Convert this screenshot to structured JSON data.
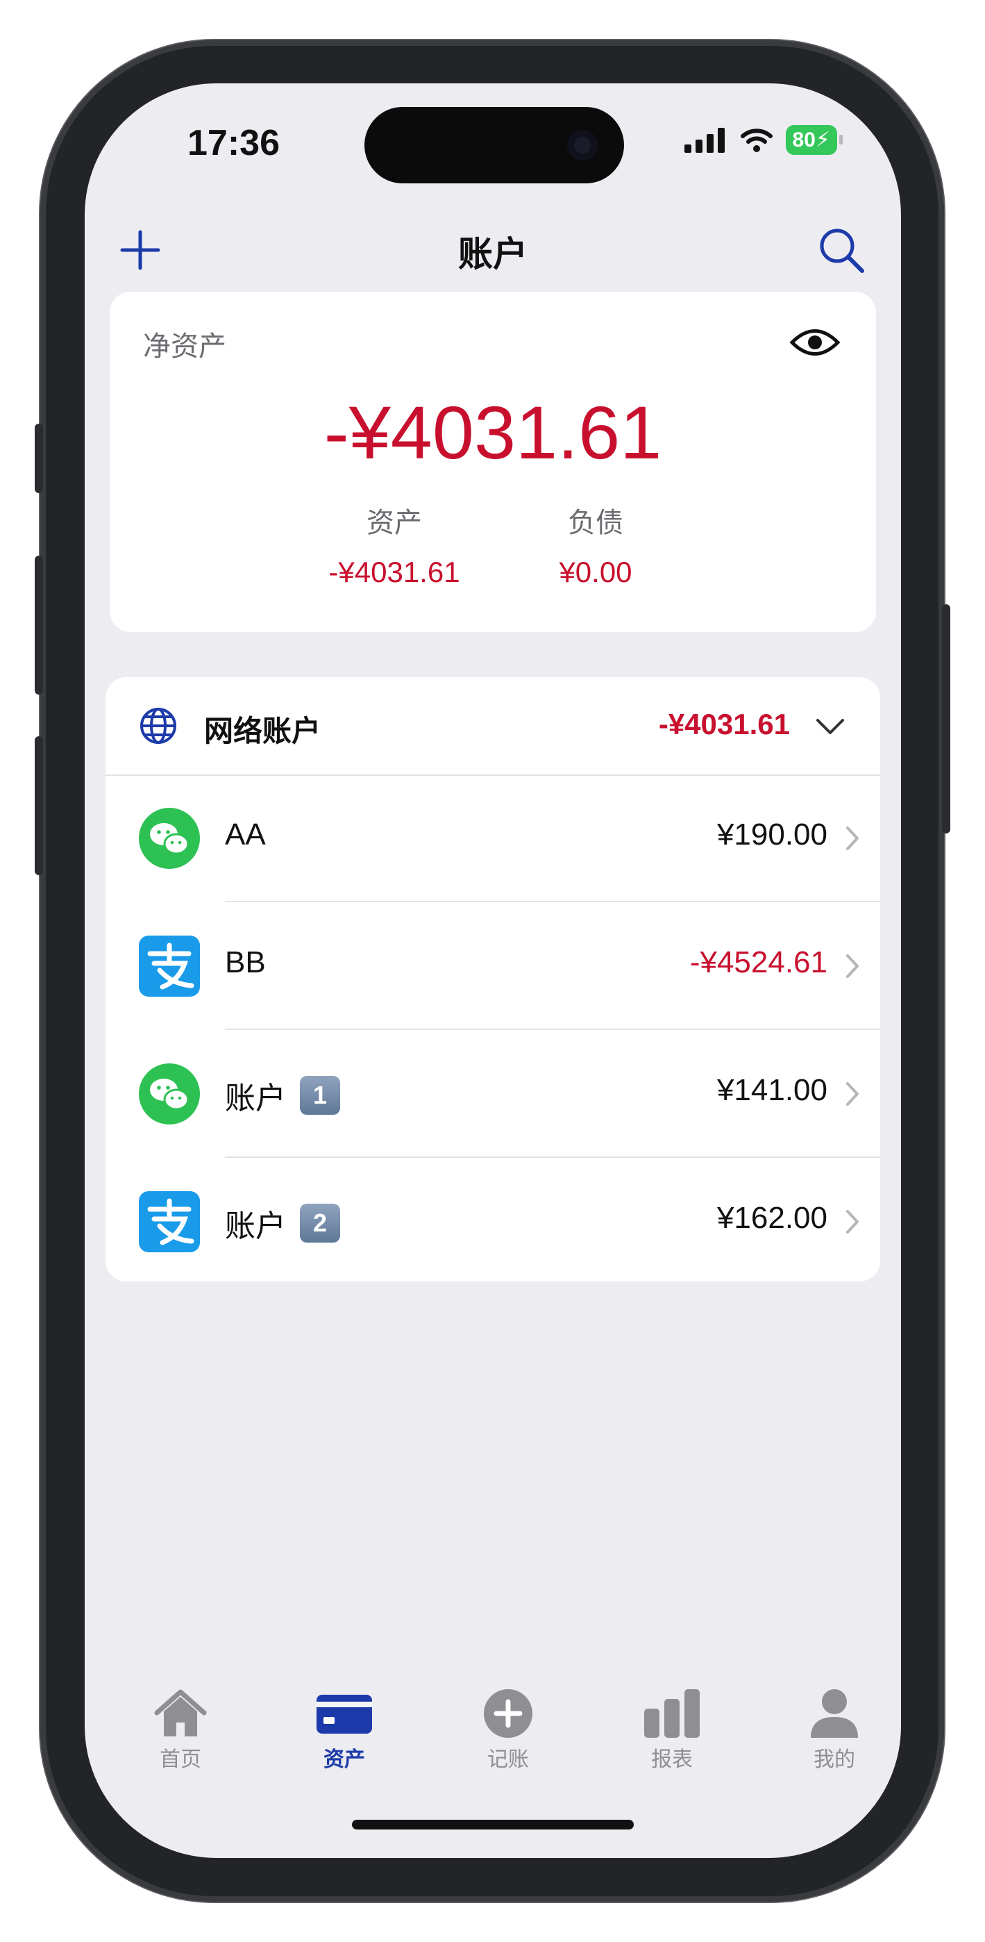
{
  "status": {
    "time": "17:36",
    "battery": "80"
  },
  "nav": {
    "title": "账户"
  },
  "net": {
    "label": "净资产",
    "amount": "-¥4031.61",
    "assets_label": "资产",
    "assets_value": "-¥4031.61",
    "liabilities_label": "负债",
    "liabilities_value": "¥0.00"
  },
  "group": {
    "name": "网络账户",
    "total": "-¥4031.61",
    "accounts": [
      {
        "name": "AA",
        "badge": "",
        "amount": "¥190.00",
        "icon": "wechat-icon"
      },
      {
        "name": "BB",
        "badge": "",
        "amount": "-¥4524.61",
        "icon": "alipay-icon"
      },
      {
        "name": "账户",
        "badge": "1",
        "amount": "¥141.00",
        "icon": "wechat-icon"
      },
      {
        "name": "账户",
        "badge": "2",
        "amount": "¥162.00",
        "icon": "alipay-icon"
      }
    ]
  },
  "tabs": [
    {
      "label": "首页",
      "icon": "house-icon"
    },
    {
      "label": "资产",
      "icon": "card-icon"
    },
    {
      "label": "记账",
      "icon": "plus-circle-icon"
    },
    {
      "label": "报表",
      "icon": "bar-chart-icon"
    },
    {
      "label": "我的",
      "icon": "person-icon"
    }
  ],
  "colors": {
    "accent": "#1c3aa9",
    "negative": "#c8102e",
    "wechat": "#2dc154",
    "alipay": "#1a9bea"
  }
}
